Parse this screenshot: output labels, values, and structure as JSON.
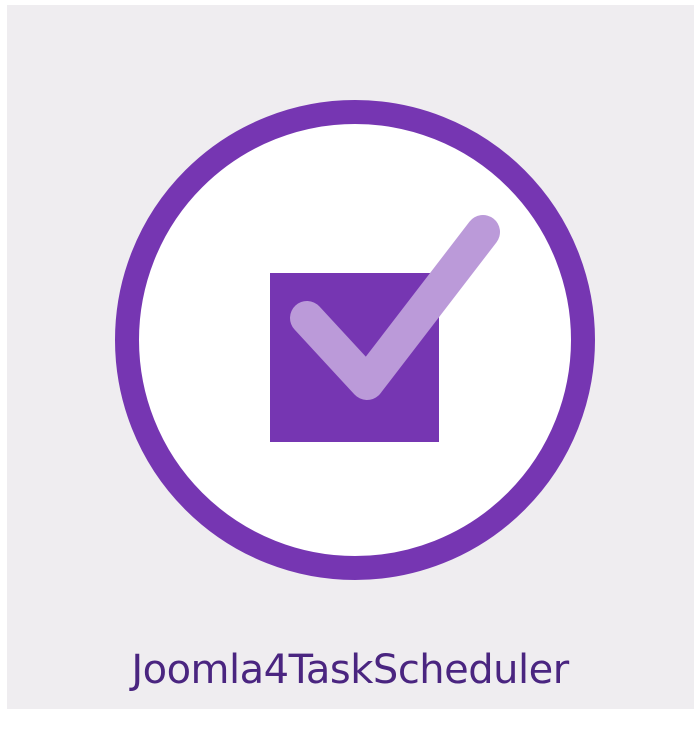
{
  "app": {
    "name": "Joomla4TaskScheduler"
  },
  "logo": {
    "icon": "checkbox-checked-icon",
    "colors": {
      "ring": "#7636b2",
      "box": "#7636b2",
      "check": "#bb9ad9",
      "inner": "#ffffff",
      "background": "#efedf0",
      "text": "#4a2580"
    }
  }
}
